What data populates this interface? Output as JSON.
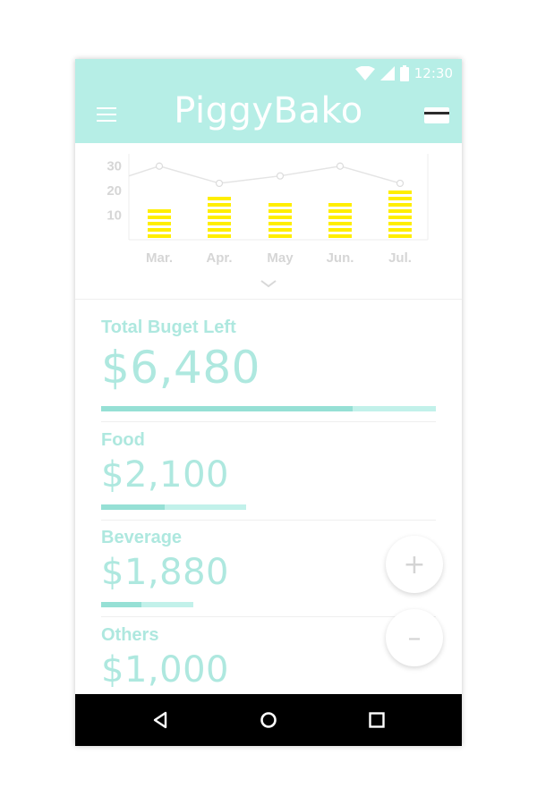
{
  "status_bar": {
    "time": "12:30",
    "icons": [
      "wifi-icon",
      "signal-icon",
      "battery-icon"
    ]
  },
  "app_bar": {
    "title": "PiggyBako",
    "menu_icon": "menu-icon",
    "card_icon": "credit-card-icon",
    "color": "#b6eee6"
  },
  "chart_data": {
    "type": "bar",
    "categories": [
      "Mar.",
      "Apr.",
      "May",
      "Jun.",
      "Jul."
    ],
    "values": [
      13,
      19,
      16,
      16,
      21
    ],
    "line_values": [
      30,
      23,
      26,
      30,
      23
    ],
    "yticks": [
      "10",
      "20",
      "30"
    ],
    "ylim": [
      0,
      35
    ],
    "bar_color": "#ffee00",
    "line_color": "#e4e4e4",
    "grid": false
  },
  "budget": {
    "total": {
      "label": "Total Buget Left",
      "amount": "$6,480",
      "progress": 0.75
    },
    "categories": [
      {
        "label": "Food",
        "amount": "$2,100",
        "progress": 0.44
      },
      {
        "label": "Beverage",
        "amount": "$1,880",
        "progress": 0.44
      },
      {
        "label": "Others",
        "amount": "$1,000"
      }
    ]
  },
  "fabs": {
    "add": "+",
    "remove": "–"
  },
  "nav": {
    "icons": [
      "back-icon",
      "home-icon",
      "recents-icon"
    ]
  },
  "colors": {
    "accent": "#aee8df",
    "bar_fill": "#96e0d5",
    "bar_track": "#c2f1ea"
  }
}
